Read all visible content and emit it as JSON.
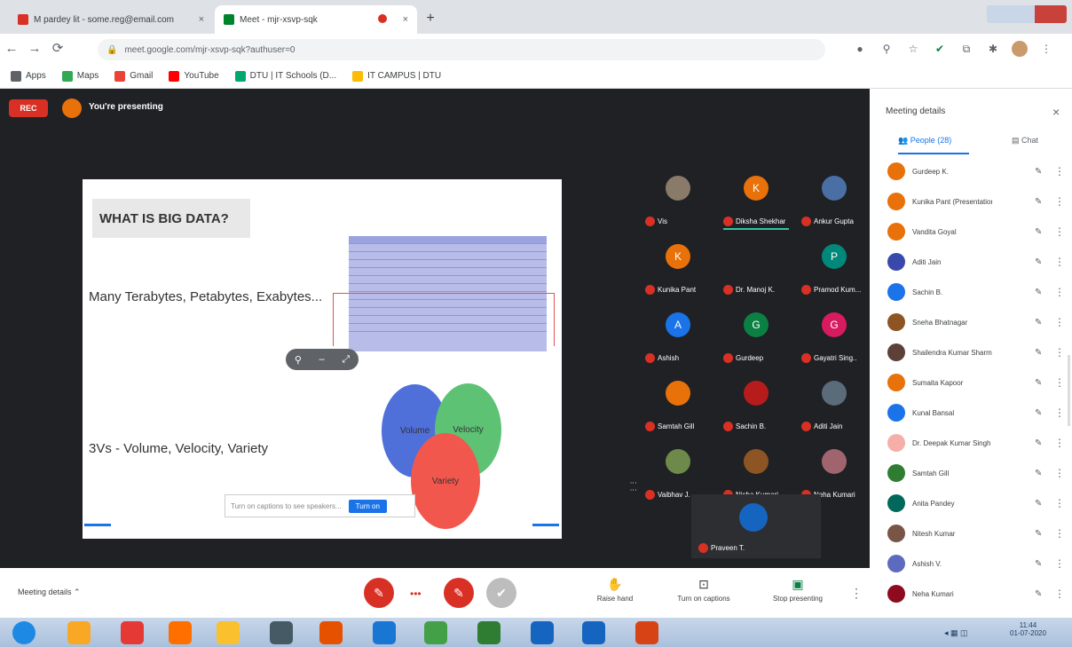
{
  "browser": {
    "tabs": [
      {
        "label": "M pardey lit - some.reg@email.com",
        "favicon_color": "#d93025"
      },
      {
        "label": "Meet - mjr-xsvp-sqk",
        "favicon_color": "#00832d"
      }
    ],
    "new_tab": "+",
    "url": "meet.google.com/mjr-xsvp-sqk?authuser=0",
    "bookmarks": [
      {
        "label": "Apps",
        "color": "#5f6368"
      },
      {
        "label": "Maps",
        "color": "#34a853"
      },
      {
        "label": "Gmail",
        "color": "#ea4335"
      },
      {
        "label": "YouTube",
        "color": "#ff0000"
      },
      {
        "label": "DTU | IT Schools (D...",
        "color": "#00a86b"
      },
      {
        "label": "IT CAMPUS | DTU",
        "color": "#fbbc04"
      }
    ]
  },
  "meet": {
    "rec_label": "REC",
    "presenter_text": "You're presenting",
    "slide": {
      "title": "WHAT IS BIG DATA?",
      "line1": "Many Terabytes, Petabytes, Exabytes...",
      "line2": "3Vs - Volume, Velocity, Variety",
      "venn": [
        "Volume",
        "Velocity",
        "Variety"
      ],
      "caption_placeholder": "Turn on captions to see speakers...",
      "caption_button": "Turn on"
    },
    "tiles": [
      {
        "name": "Vis",
        "initial": "",
        "color": "#8a7a6a"
      },
      {
        "name": "Diksha Shekhar",
        "initial": "K",
        "color": "#e8710a"
      },
      {
        "name": "Ankur Gupta",
        "initial": "",
        "color": "#4a6fa5"
      },
      {
        "name": "Kunika Pant",
        "initial": "K",
        "color": "#e8710a"
      },
      {
        "name": "Dr. Manoj K.",
        "initial": "",
        "color": "#202124"
      },
      {
        "name": "Pramod Kum...",
        "initial": "P",
        "color": "#00897b"
      },
      {
        "name": "Ashish",
        "initial": "A",
        "color": "#1a73e8"
      },
      {
        "name": "Gurdeep",
        "initial": "G",
        "color": "#0b8043"
      },
      {
        "name": "Gayatri Sing..",
        "initial": "G",
        "color": "#d81b60"
      },
      {
        "name": "Samtah Gill",
        "initial": "",
        "color": "#e8710a"
      },
      {
        "name": "Sachin B.",
        "initial": "",
        "color": "#b71c1c"
      },
      {
        "name": "Aditi Jain",
        "initial": "",
        "color": "#5a6b7a"
      },
      {
        "name": "Vaibhav J.",
        "initial": "",
        "color": "#6d8a4a"
      },
      {
        "name": "Nisha Kumari",
        "initial": "",
        "color": "#8d5524"
      },
      {
        "name": "Neha Kumari",
        "initial": "",
        "color": "#a0646e"
      }
    ],
    "self": {
      "name": "Praveen T."
    },
    "meeting_details": "Meeting details",
    "bottom_actions": [
      {
        "label": "Raise hand",
        "icon": "hand-icon"
      },
      {
        "label": "Turn on captions",
        "icon": "captions-icon"
      },
      {
        "label": "Stop presenting",
        "icon": "present-icon"
      }
    ]
  },
  "people": {
    "title": "Meeting details",
    "tab_people": "People (28)",
    "tab_chat": "Chat",
    "list": [
      {
        "name": "Gurdeep K.",
        "color": "#e8710a"
      },
      {
        "name": "Kunika Pant (Presentation)",
        "color": "#e8710a"
      },
      {
        "name": "Vandita Goyal",
        "color": "#e8710a"
      },
      {
        "name": "Aditi Jain",
        "color": "#3949ab"
      },
      {
        "name": "Sachin B.",
        "color": "#1a73e8"
      },
      {
        "name": "Sneha Bhatnagar",
        "color": "#8d5524"
      },
      {
        "name": "Shailendra Kumar Sharma",
        "color": "#5d4037"
      },
      {
        "name": "Sumaita Kapoor",
        "color": "#e8710a"
      },
      {
        "name": "Kunal Bansal",
        "color": "#1a73e8"
      },
      {
        "name": "Dr. Deepak Kumar Singh",
        "color": "#f6aea9"
      },
      {
        "name": "Samtah Gill",
        "color": "#2e7d32"
      },
      {
        "name": "Anita Pandey",
        "color": "#00695c"
      },
      {
        "name": "Nitesh Kumar",
        "color": "#795548"
      },
      {
        "name": "Ashish V.",
        "color": "#5c6bc0"
      },
      {
        "name": "Neha Kumari",
        "color": "#8e0a1e"
      }
    ]
  },
  "taskbar": {
    "icons": [
      {
        "name": "start-icon",
        "color": "#1e88e5"
      },
      {
        "name": "explorer-icon",
        "color": "#f9a825"
      },
      {
        "name": "chrome-icon",
        "color": "#e53935"
      },
      {
        "name": "firefox-icon",
        "color": "#ff6f00"
      },
      {
        "name": "folder-icon",
        "color": "#fbc02d"
      },
      {
        "name": "app-icon",
        "color": "#455a64"
      },
      {
        "name": "media-icon",
        "color": "#e65100"
      },
      {
        "name": "ie-icon",
        "color": "#1976d2"
      },
      {
        "name": "chrome2-icon",
        "color": "#43a047"
      },
      {
        "name": "excel-icon",
        "color": "#2e7d32"
      },
      {
        "name": "outlook-icon",
        "color": "#1565c0"
      },
      {
        "name": "word-icon",
        "color": "#1565c0"
      },
      {
        "name": "powerpoint-icon",
        "color": "#d84315"
      }
    ],
    "time": "11:44",
    "date": "01-07-2020"
  }
}
